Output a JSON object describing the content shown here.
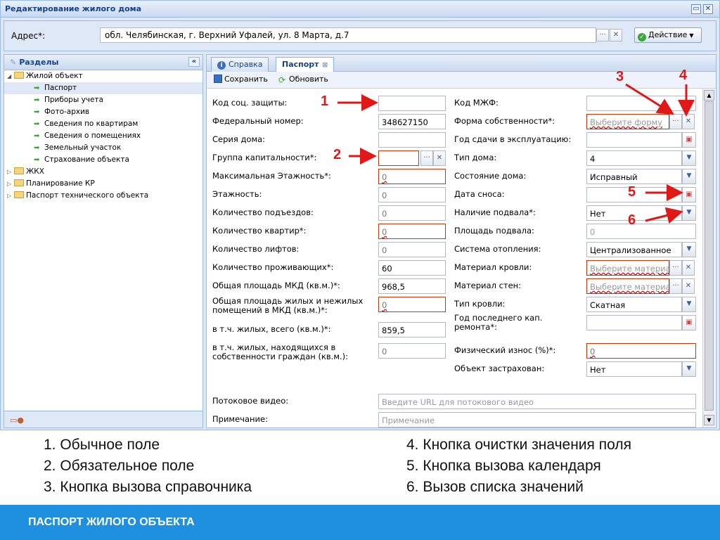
{
  "window": {
    "title": "Редактирование жилого дома"
  },
  "address": {
    "label": "Адрес*:",
    "value": "обл. Челябинская, г. Верхний Уфалей, ул. 8 Марта, д.7",
    "action_label": "Действие"
  },
  "sidebar": {
    "title": "Разделы",
    "items": [
      {
        "label": "Жилой объект",
        "type": "folder",
        "open": true
      },
      {
        "label": "Паспорт",
        "type": "leaf",
        "selected": true
      },
      {
        "label": "Приборы учета",
        "type": "leaf"
      },
      {
        "label": "Фото-архив",
        "type": "leaf"
      },
      {
        "label": "Сведения по квартирам",
        "type": "leaf"
      },
      {
        "label": "Сведения о помещениях",
        "type": "leaf"
      },
      {
        "label": "Земельный участок",
        "type": "leaf"
      },
      {
        "label": "Страхование объекта",
        "type": "leaf"
      },
      {
        "label": "ЖКХ",
        "type": "folder"
      },
      {
        "label": "Планирование КР",
        "type": "folder"
      },
      {
        "label": "Паспорт технического объекта",
        "type": "folder"
      }
    ]
  },
  "tabs": [
    {
      "label": "Справка"
    },
    {
      "label": "Паспорт",
      "active": true
    }
  ],
  "toolbar": {
    "save_label": "Сохранить",
    "refresh_label": "Обновить"
  },
  "form_left": [
    {
      "label": "Код соц. защиты:",
      "value": ""
    },
    {
      "label": "Федеральный номер:",
      "value": "348627150"
    },
    {
      "label": "Серия дома:",
      "value": ""
    },
    {
      "label": "Группа капитальности*:",
      "value": ""
    },
    {
      "label": "Максимальная Этажность*:",
      "value": "0"
    },
    {
      "label": "Этажность:",
      "value": "0"
    },
    {
      "label": "Количество подъездов:",
      "value": "0"
    },
    {
      "label": "Количество квартир*:",
      "value": "0"
    },
    {
      "label": "Количество лифтов:",
      "value": "0"
    },
    {
      "label": "Количество проживающих*:",
      "value": "60"
    },
    {
      "label": "Общая площадь МКД (кв.м.)*:",
      "value": "968,5"
    },
    {
      "label": "Общая площадь жилых и нежилых помещений в МКД (кв.м.)*:",
      "value": "0"
    },
    {
      "label": "в т.ч. жилых, всего (кв.м.)*:",
      "value": "859,5"
    },
    {
      "label": "в т.ч. жилых, находящихся в собственности граждан (кв.м.):",
      "value": "0"
    }
  ],
  "form_right": [
    {
      "label": "Код МЖФ:",
      "value": ""
    },
    {
      "label": "Форма собственности*:",
      "value": "Выберите форму"
    },
    {
      "label": "Год сдачи в эксплуатацию:",
      "value": ""
    },
    {
      "label": "Тип дома:",
      "value": "4"
    },
    {
      "label": "Состояние дома:",
      "value": "Исправный"
    },
    {
      "label": "Дата сноса:",
      "value": ""
    },
    {
      "label": "Наличие подвала*:",
      "value": "Нет"
    },
    {
      "label": "Площадь подвала:",
      "value": "0"
    },
    {
      "label": "Система отопления:",
      "value": "Централизованное"
    },
    {
      "label": "Материал кровли:",
      "value": "Выберите материал"
    },
    {
      "label": "Материал стен:",
      "value": "Выберите материал"
    },
    {
      "label": "Тип кровли:",
      "value": "Скатная"
    },
    {
      "label": "Год последнего кап. ремонта*:",
      "value": ""
    },
    {
      "label": "Физический износ (%)*:",
      "value": "0"
    },
    {
      "label": "Объект застрахован:",
      "value": "Нет"
    }
  ],
  "video": {
    "label": "Потоковое видео:",
    "placeholder": "Введите URL для потокового видео"
  },
  "note": {
    "label": "Примечание:",
    "placeholder": "Примечание"
  },
  "annotations": [
    "1",
    "2",
    "3",
    "4",
    "5",
    "6"
  ],
  "legend_left": [
    "1.  Обычное поле",
    "2.  Обязательное поле",
    "3.  Кнопка вызова справочника"
  ],
  "legend_right": [
    "4. Кнопка очистки значения поля",
    "5. Кнопка вызова календаря",
    "6. Вызов списка значений"
  ],
  "footer": {
    "title": "ПАСПОРТ ЖИЛОГО ОБЪЕКТА"
  },
  "colors": {
    "accent": "#1f8fe0",
    "annotation": "#e01818",
    "required_border": "#cc3300",
    "panel": "#dfe8f6"
  }
}
